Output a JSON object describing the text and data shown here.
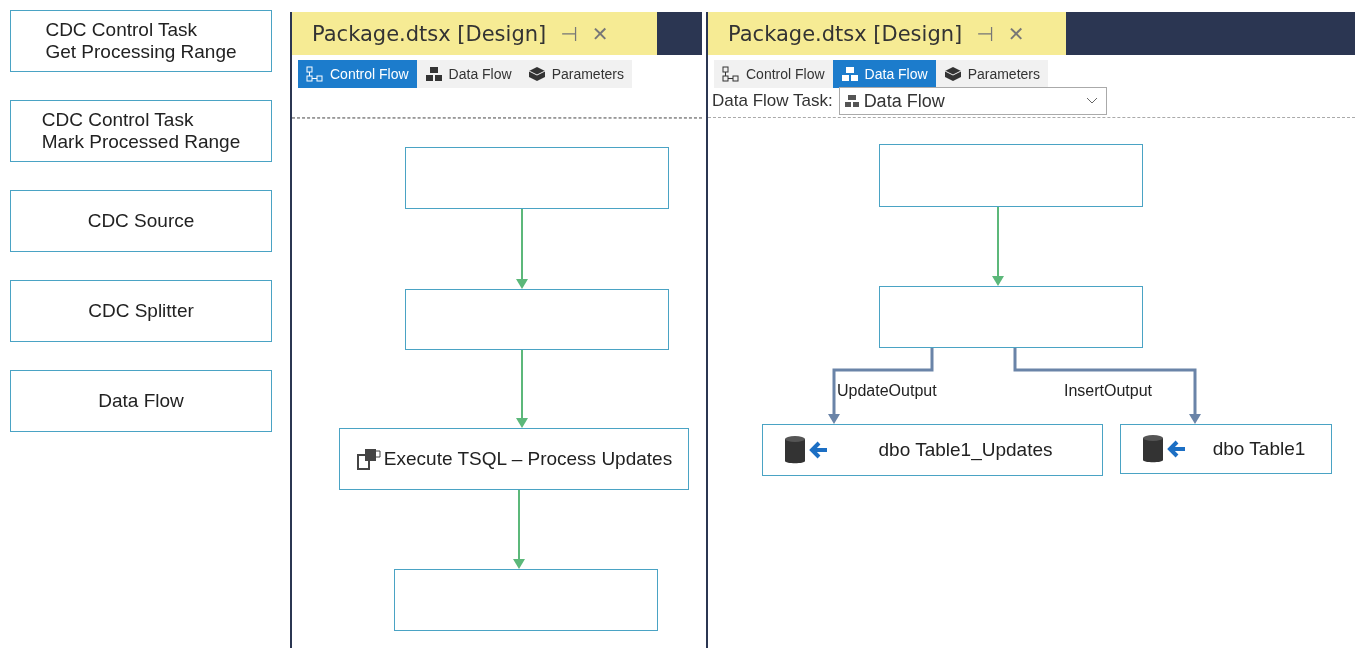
{
  "palette": [
    {
      "label": "CDC Control Task\nGet Processing Range"
    },
    {
      "label": "CDC Control Task\nMark Processed Range"
    },
    {
      "label": "CDC Source"
    },
    {
      "label": "CDC Splitter"
    },
    {
      "label": "Data Flow"
    }
  ],
  "panels": [
    {
      "title": "Package.dtsx [Design]",
      "pin": "⊣",
      "close": "✕",
      "tabs": [
        {
          "label": "Control Flow",
          "selected": true
        },
        {
          "label": "Data Flow",
          "selected": false
        },
        {
          "label": "Parameters",
          "selected": false
        }
      ],
      "nodes": [
        {
          "kind": "empty"
        },
        {
          "kind": "empty"
        },
        {
          "kind": "task",
          "label": "Execute TSQL – Process Updates"
        },
        {
          "kind": "empty"
        }
      ],
      "connectors": [
        {
          "kind": "flow"
        },
        {
          "kind": "flow"
        },
        {
          "kind": "flow"
        }
      ]
    },
    {
      "title": "Package.dtsx [Design]",
      "pin": "⊣",
      "close": "✕",
      "tabs": [
        {
          "label": "Control Flow",
          "selected": false
        },
        {
          "label": "Data Flow",
          "selected": true
        },
        {
          "label": "Parameters",
          "selected": false
        }
      ],
      "task_selector": {
        "label": "Data Flow Task:",
        "value": "Data Flow"
      },
      "nodes": [
        {
          "kind": "empty"
        },
        {
          "kind": "empty"
        },
        {
          "kind": "destination",
          "label": "dbo Table1_Updates"
        },
        {
          "kind": "destination",
          "label": "dbo Table1"
        }
      ],
      "connectors": [
        {
          "kind": "flow"
        },
        {
          "kind": "output",
          "label": "UpdateOutput"
        },
        {
          "kind": "output",
          "label": "InsertOutput"
        }
      ]
    }
  ]
}
